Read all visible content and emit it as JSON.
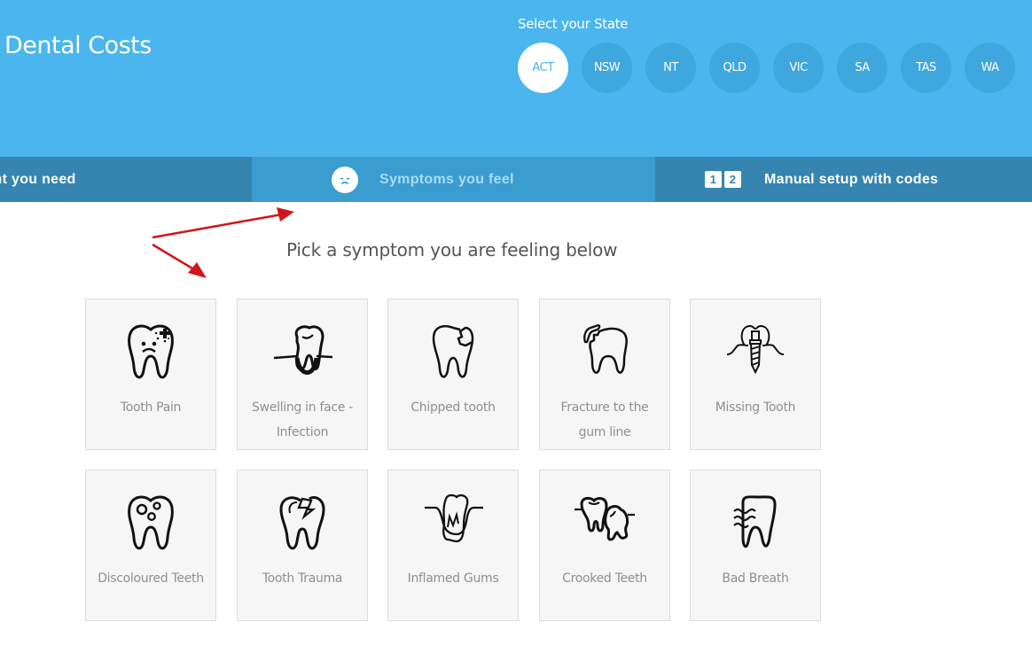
{
  "header": {
    "title": "Dental Costs",
    "state_label": "Select your State",
    "states": [
      {
        "label": "ACT",
        "selected": true
      },
      {
        "label": "NSW",
        "selected": false
      },
      {
        "label": "NT",
        "selected": false
      },
      {
        "label": "QLD",
        "selected": false
      },
      {
        "label": "VIC",
        "selected": false
      },
      {
        "label": "SA",
        "selected": false
      },
      {
        "label": "TAS",
        "selected": false
      },
      {
        "label": "WA",
        "selected": false
      }
    ]
  },
  "nav": {
    "tabs": [
      {
        "label": "Treatment you need",
        "visible_label": "atment you need",
        "icon": "none"
      },
      {
        "label": "Symptoms you feel",
        "icon": "sad-face-icon",
        "active": true
      },
      {
        "label": "Manual setup with codes",
        "icon": "codes-1-2-icon",
        "code_digits": [
          "1",
          "2"
        ]
      }
    ]
  },
  "main": {
    "heading": "Pick a symptom you are feeling below",
    "symptoms": [
      {
        "label": "Tooth Pain",
        "icon": "tooth-pain-icon"
      },
      {
        "label": "Swelling in face - Infection",
        "icon": "tooth-swelling-icon"
      },
      {
        "label": "Chipped tooth",
        "icon": "chipped-tooth-icon"
      },
      {
        "label": "Fracture to the gum line",
        "icon": "fractured-tooth-icon"
      },
      {
        "label": "Missing Tooth",
        "icon": "dental-implant-icon"
      },
      {
        "label": "Discoloured Teeth",
        "icon": "discoloured-tooth-icon"
      },
      {
        "label": "Tooth Trauma",
        "icon": "cracked-tooth-icon"
      },
      {
        "label": "Inflamed Gums",
        "icon": "inflamed-gums-icon"
      },
      {
        "label": "Crooked Teeth",
        "icon": "crooked-teeth-icon"
      },
      {
        "label": "Bad Breath",
        "icon": "bad-breath-icon"
      }
    ]
  },
  "colors": {
    "header_bg": "#4ab6ed",
    "state_bubble": "#3ea7dd",
    "tab_dark": "#3585b0",
    "tab_active": "#3a9ccf",
    "annotation_arrow": "#d0161a"
  }
}
